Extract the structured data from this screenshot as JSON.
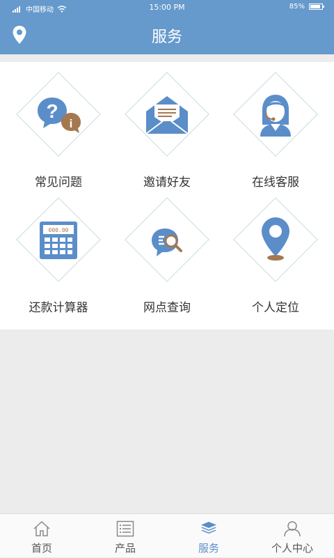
{
  "status_bar": {
    "carrier": "中国移动",
    "time": "15:00 PM",
    "battery": "85%",
    "battery_level": 0.85
  },
  "header": {
    "title": "服务"
  },
  "services": [
    {
      "label": "常见问题",
      "icon": "faq-icon"
    },
    {
      "label": "邀请好友",
      "icon": "envelope-icon"
    },
    {
      "label": "在线客服",
      "icon": "customer-service-icon"
    },
    {
      "label": "还款计算器",
      "icon": "calculator-icon"
    },
    {
      "label": "网点查询",
      "icon": "branch-search-icon"
    },
    {
      "label": "个人定位",
      "icon": "location-pin-icon"
    }
  ],
  "tabs": [
    {
      "label": "首页",
      "icon": "home-icon",
      "active": false
    },
    {
      "label": "产品",
      "icon": "list-icon",
      "active": false
    },
    {
      "label": "服务",
      "icon": "layers-icon",
      "active": true
    },
    {
      "label": "个人中心",
      "icon": "user-icon",
      "active": false
    }
  ],
  "colors": {
    "primary": "#6699cc",
    "icon_blue": "#5b8ec9",
    "icon_brown": "#a5784f",
    "diamond_border": "#c7dbe0",
    "page_bg": "#ececec"
  }
}
